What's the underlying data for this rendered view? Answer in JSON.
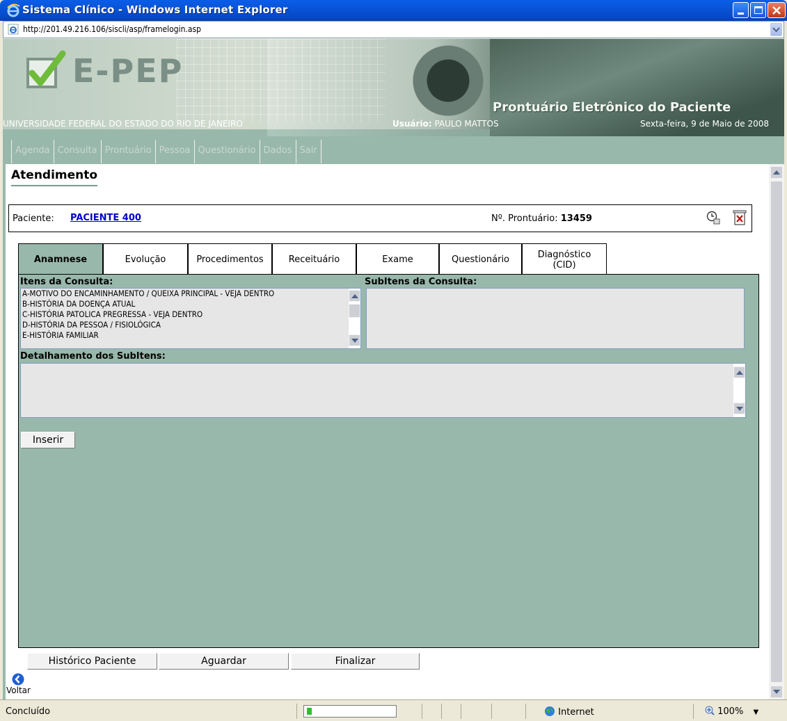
{
  "window": {
    "title": "Sistema Clínico - Windows Internet Explorer"
  },
  "address": {
    "url": "http://201.49.216.106/siscli/asp/framelogin.asp"
  },
  "header": {
    "brand": "E-PEP",
    "subtitle": "Prontuário Eletrônico do Paciente",
    "university": "UNIVERSIDADE FEDERAL DO ESTADO DO RIO DE JANEIRO",
    "user_label": "Usuário:",
    "user_name": "PAULO MATTOS",
    "date": "Sexta-feira, 9 de Maio de 2008"
  },
  "menu": [
    "Agenda",
    "Consulta",
    "Prontuário",
    "Pessoa",
    "Questionário",
    "Dados",
    "Sair"
  ],
  "page": {
    "title": "Atendimento",
    "patient_label": "Paciente:",
    "patient_name": "PACIENTE 400",
    "record_label": "Nº. Prontuário:",
    "record_number": "13459"
  },
  "tabs": [
    {
      "label": "Anamnese",
      "active": true
    },
    {
      "label": "Evolução"
    },
    {
      "label": "Procedimentos"
    },
    {
      "label": "Receituário"
    },
    {
      "label": "Exame"
    },
    {
      "label": "Questionário"
    },
    {
      "label_line1": "Diagnóstico",
      "label_line2": "(CID)"
    }
  ],
  "panel": {
    "items_label": "Itens da Consulta:",
    "subitems_label": "SubItens da Consulta:",
    "detail_label": "Detalhamento dos SubItens:",
    "items": [
      "A-MOTIVO DO ENCAMINHAMENTO / QUEIXA PRINCIPAL - VEJA DENTRO",
      "B-HISTÓRIA DA DOENÇA ATUAL",
      "C-HISTÓRIA PATOLICA PREGRESSA - VEJA DENTRO",
      "D-HISTÓRIA DA PESSOA / FISIOLÓGICA",
      "E-HISTÓRIA FAMILIAR"
    ],
    "insert_button": "Inserir"
  },
  "actions": {
    "history": "Histórico Paciente",
    "wait": "Aguardar",
    "finish": "Finalizar",
    "back": "Voltar"
  },
  "status": {
    "text": "Concluído",
    "zone": "Internet",
    "zoom": "100%"
  }
}
